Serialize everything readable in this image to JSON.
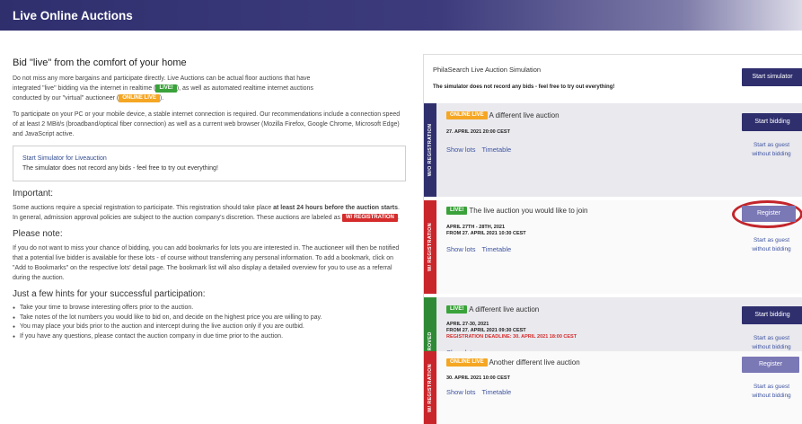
{
  "header": {
    "title": "Live Online Auctions"
  },
  "intro": {
    "heading": "Bid \"live\" from the comfort of your home",
    "p1a": "Do not miss any more bargains and participate directly. Live Auctions can be actual floor auctions that have",
    "p1b": "integrated \"live\" bidding via the internet in realtime (",
    "badge_live": "LIVE!",
    "p1c": "), as well as automated realtime internet auctions",
    "p1d": "conducted by our \"virtual\" auctioneer (",
    "badge_online": "ONLINE LIVE",
    "p1e": ").",
    "p2": "To participate on your PC or your mobile device, a stable internet connection is required. Our recommendations include a connection speed of at least 2 MBit/s (broadband/optical fiber connection) as well as a current web browser (Mozilla Firefox, Google Chrome, Microsoft Edge) and JavaScript active."
  },
  "simbox": {
    "link": "Start Simulator for Liveauction",
    "text": "The simulator does not record any bids - feel free to try out everything!"
  },
  "important": {
    "heading": "Important:",
    "t1": "Some auctions require a special registration to participate. This registration should take place ",
    "bold": "at least 24 hours before the auction starts",
    "t2": ". In general, admission approval policies are subject to the auction company's discretion. These auctions are labeled as ",
    "badge": "W/ REGISTRATION",
    "t3": "."
  },
  "note": {
    "heading": "Please note:",
    "text": "If you do not want to miss your chance of bidding, you can add bookmarks for lots you are interested in. The auctioneer will then be notified that a potential live bidder is available for these lots - of course without transferring any personal information. To add a bookmark, click on \"Add to Bookmarks\" on the respective lots' detail page. The bookmark list will also display a detailed overview for you to use as a referral during the auction."
  },
  "hints": {
    "heading": "Just a few hints for your successful participation:",
    "items": [
      "Take your time to browse interesting offers prior to the auction.",
      "Take notes of the lot numbers you would like to bid on, and decide on the highest price you are willing to pay.",
      "You may place your bids prior to the auction and intercept during the live auction only if you are outbid.",
      "If you have any questions, please contact the auction company in due time prior to the auction."
    ]
  },
  "simulation": {
    "title": "PhilaSearch Live Auction Simulation",
    "subtitle": "The simulator does not record any bids - feel free to try out everything!",
    "button": "Start simulator"
  },
  "auctions": [
    {
      "tab": "W/O REGISTRATION",
      "badge": "ONLINE LIVE",
      "title": "A different live auction",
      "date1": "27. APRIL 2021 20:00 CEST",
      "date2": "",
      "deadline": "",
      "links": [
        "Show lots",
        "Timetable"
      ],
      "button": "Start bidding",
      "guest1": "Start as guest",
      "guest2": "without bidding"
    },
    {
      "tab": "W/ REGISTRATION",
      "badge": "LIVE!",
      "title": "The live auction you would like to join",
      "date1": "APRIL 27TH - 28TH, 2021",
      "date2": "FROM 27. APRIL 2021 10:30 CEST",
      "deadline": "",
      "links": [
        "Show lots",
        "Timetable"
      ],
      "button": "Register",
      "guest1": "Start as guest",
      "guest2": "without bidding"
    },
    {
      "tab": "APPROVED",
      "badge": "LIVE!",
      "title": "A different live auction",
      "date1": "APRIL 27-30, 2021",
      "date2": "FROM 27. APRIL 2021 09:30 CEST",
      "deadline": "REGISTRATION DEADLINE: 30. APRIL 2021 18:00 CEST",
      "links": [
        "Show lots"
      ],
      "button": "Start bidding",
      "guest1": "Start as guest",
      "guest2": "without bidding"
    },
    {
      "tab": "W/ REGISTRATION",
      "badge": "ONLINE LIVE",
      "title": "Another different live auction",
      "date1": "30. APRIL 2021 10:00 CEST",
      "date2": "",
      "deadline": "",
      "links": [
        "Show lots",
        "Timetable"
      ],
      "button": "Register",
      "guest1": "Start as guest",
      "guest2": "without bidding"
    }
  ],
  "colors": {
    "navy": "#2f2f6e",
    "red": "#c8262b",
    "green": "#2f8a36",
    "orange": "#f5a623",
    "live_green": "#3aa23a"
  }
}
